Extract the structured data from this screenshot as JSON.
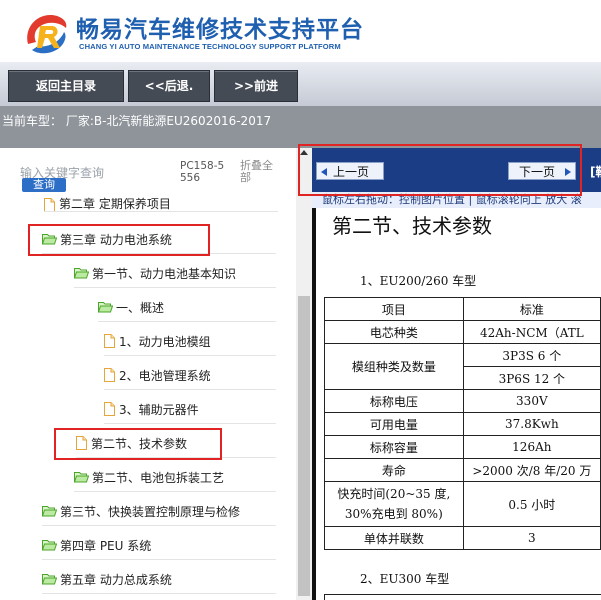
{
  "header": {
    "title": "畅易汽车维修技术支持平台",
    "subtitle": "CHANG YI AUTO MAINTENANCE TECHNOLOGY SUPPORT PLATFORM"
  },
  "toolbar": {
    "home_label": "返回主目录",
    "back_label": "<<后退.",
    "forward_label": ">>前进"
  },
  "vehicle": {
    "current_label": "当前车型： 厂家:B-北汽新能源EU2602016-2017"
  },
  "search": {
    "placeholder": "输入关键字查询",
    "button_label": "查询"
  },
  "side_labels": {
    "pc": "PC158-5556",
    "collapse": "折叠全部"
  },
  "tree": {
    "items": [
      {
        "label": "第二章 定期保养项目",
        "type": "doc"
      },
      {
        "label": "第三章 动力电池系统",
        "type": "folder"
      },
      {
        "label": "第一节、动力电池基本知识",
        "type": "folder"
      },
      {
        "label": "一、概述",
        "type": "folder"
      },
      {
        "label": "1、动力电池模组",
        "type": "doc"
      },
      {
        "label": "2、电池管理系统",
        "type": "doc"
      },
      {
        "label": "3、辅助元器件",
        "type": "doc"
      },
      {
        "label": "第二节、技术参数",
        "type": "doc"
      },
      {
        "label": "第二节、电池包拆装工艺",
        "type": "folder"
      },
      {
        "label": "第三节、快换装置控制原理与检修",
        "type": "folder"
      },
      {
        "label": "第四章 PEU 系统",
        "type": "folder"
      },
      {
        "label": "第五章 动力总成系统",
        "type": "folder"
      }
    ]
  },
  "pager": {
    "prev_label": "上一页",
    "next_label": "下一页",
    "tail": "[鞍"
  },
  "hint": {
    "text": "鼠标左右拖动：控制图片位置 | 鼠标滚轮向上 放大  滚"
  },
  "document": {
    "title": "第二节、技术参数",
    "section1": "1、EU200/260 车型",
    "section2": "2、EU300 车型",
    "table": {
      "head": [
        "项目",
        "标准"
      ],
      "cells": {
        "cell_type": "电芯种类",
        "cell_type_v": "42Ah-NCM（ATL",
        "module": "模组种类及数量",
        "module_v1": "3P3S     6 个",
        "module_v2": "3P6S    12 个",
        "voltage": "标称电压",
        "voltage_v": "330V",
        "energy": "可用电量",
        "energy_v": "37.8Kwh",
        "capacity": "标称容量",
        "capacity_v": "126Ah",
        "life": "寿命",
        "life_v": ">2000 次/8 年/20 万",
        "fast1": "快充时间(20~35 度,",
        "fast2": "30%充电到 80%)",
        "fast_v": "0.5 小时",
        "parallel": "单体并联数",
        "parallel_v": "3"
      }
    }
  },
  "colors": {
    "brand_blue": "#1f5fb0",
    "highlight_red": "#e02424",
    "nav_blue": "#1b3d86"
  }
}
